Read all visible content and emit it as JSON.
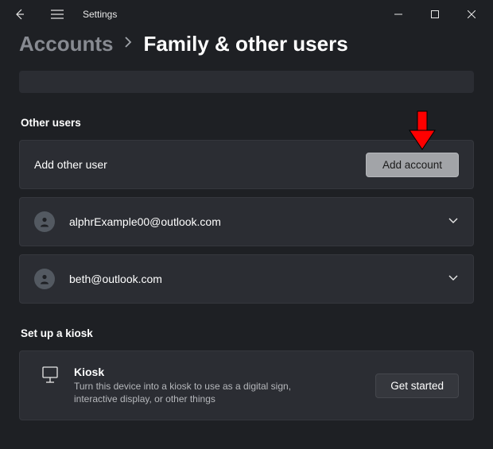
{
  "titlebar": {
    "app_title": "Settings"
  },
  "breadcrumb": {
    "parent": "Accounts",
    "current": "Family & other users"
  },
  "other_users": {
    "section_title": "Other users",
    "add_label": "Add other user",
    "add_button": "Add account",
    "users": [
      {
        "email": "alphrExample00@outlook.com"
      },
      {
        "email": "beth@outlook.com"
      }
    ]
  },
  "kiosk": {
    "section_title": "Set up a kiosk",
    "title": "Kiosk",
    "description": "Turn this device into a kiosk to use as a digital sign, interactive display, or other things",
    "button": "Get started"
  }
}
